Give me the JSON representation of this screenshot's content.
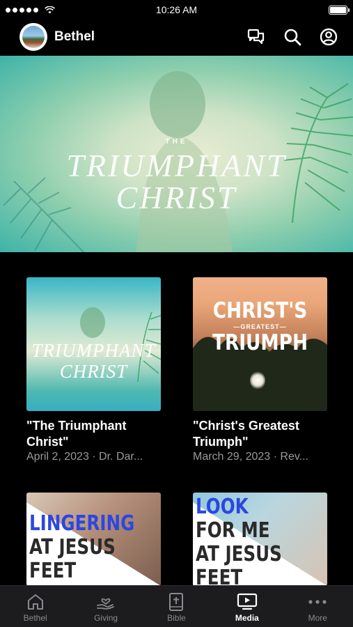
{
  "status_bar": {
    "time": "10:26 AM"
  },
  "header": {
    "church_name": "Bethel",
    "icons": [
      "chat-icon",
      "search-icon",
      "profile-icon"
    ]
  },
  "hero": {
    "small_word": "THE",
    "title_line1": "TRIUMPHANT",
    "title_line2": "CHRIST"
  },
  "media_items": [
    {
      "thumb_lines": [
        "TRIUMPHANT",
        "CHRIST"
      ],
      "title": "\"The Triumphant Christ\"",
      "meta": "April 2, 2023 · Dr. Dar..."
    },
    {
      "thumb_lines": [
        "CHRIST'S",
        "—GREATEST—",
        "TRIUMPH"
      ],
      "title": "\"Christ's Greatest Triumph\"",
      "meta": "March 29, 2023 · Rev..."
    },
    {
      "thumb_lines": [
        "LINGERING",
        "AT JESUS",
        "FEET"
      ]
    },
    {
      "thumb_lines": [
        "LOOK",
        "FOR ME",
        "AT JESUS",
        "FEET"
      ]
    }
  ],
  "tabs": [
    {
      "label": "Bethel",
      "icon": "home-icon"
    },
    {
      "label": "Giving",
      "icon": "giving-icon"
    },
    {
      "label": "Bible",
      "icon": "bible-icon"
    },
    {
      "label": "Media",
      "icon": "media-icon",
      "active": true
    },
    {
      "label": "More",
      "icon": "more-icon"
    }
  ],
  "colors": {
    "background": "#000000",
    "tab_bar": "#1c1c1e",
    "meta_text": "#9a9a9a",
    "accent_blue": "#2c47e0"
  }
}
